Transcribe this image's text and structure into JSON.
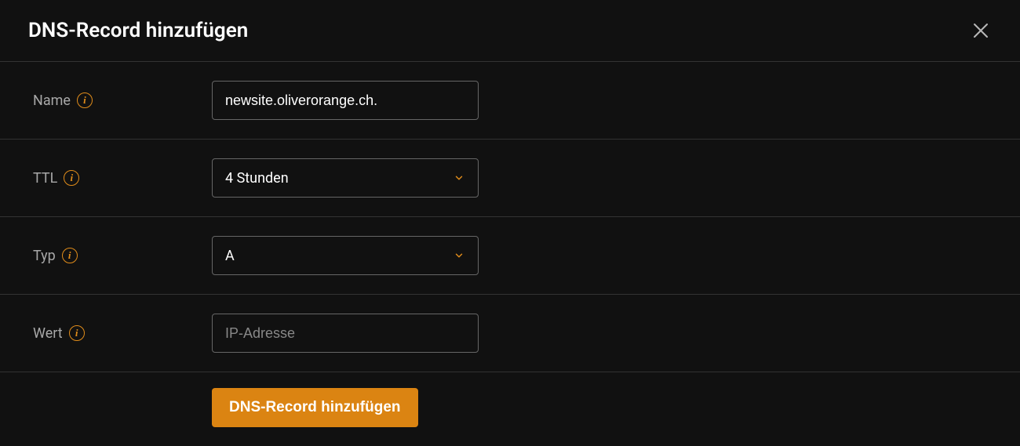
{
  "header": {
    "title": "DNS-Record hinzufügen"
  },
  "fields": {
    "name": {
      "label": "Name",
      "value": "newsite.oliverorange.ch."
    },
    "ttl": {
      "label": "TTL",
      "value": "4 Stunden"
    },
    "type": {
      "label": "Typ",
      "value": "A"
    },
    "wert": {
      "label": "Wert",
      "placeholder": "IP-Adresse"
    }
  },
  "submit": {
    "label": "DNS-Record hinzufügen"
  },
  "info_glyph": "i"
}
